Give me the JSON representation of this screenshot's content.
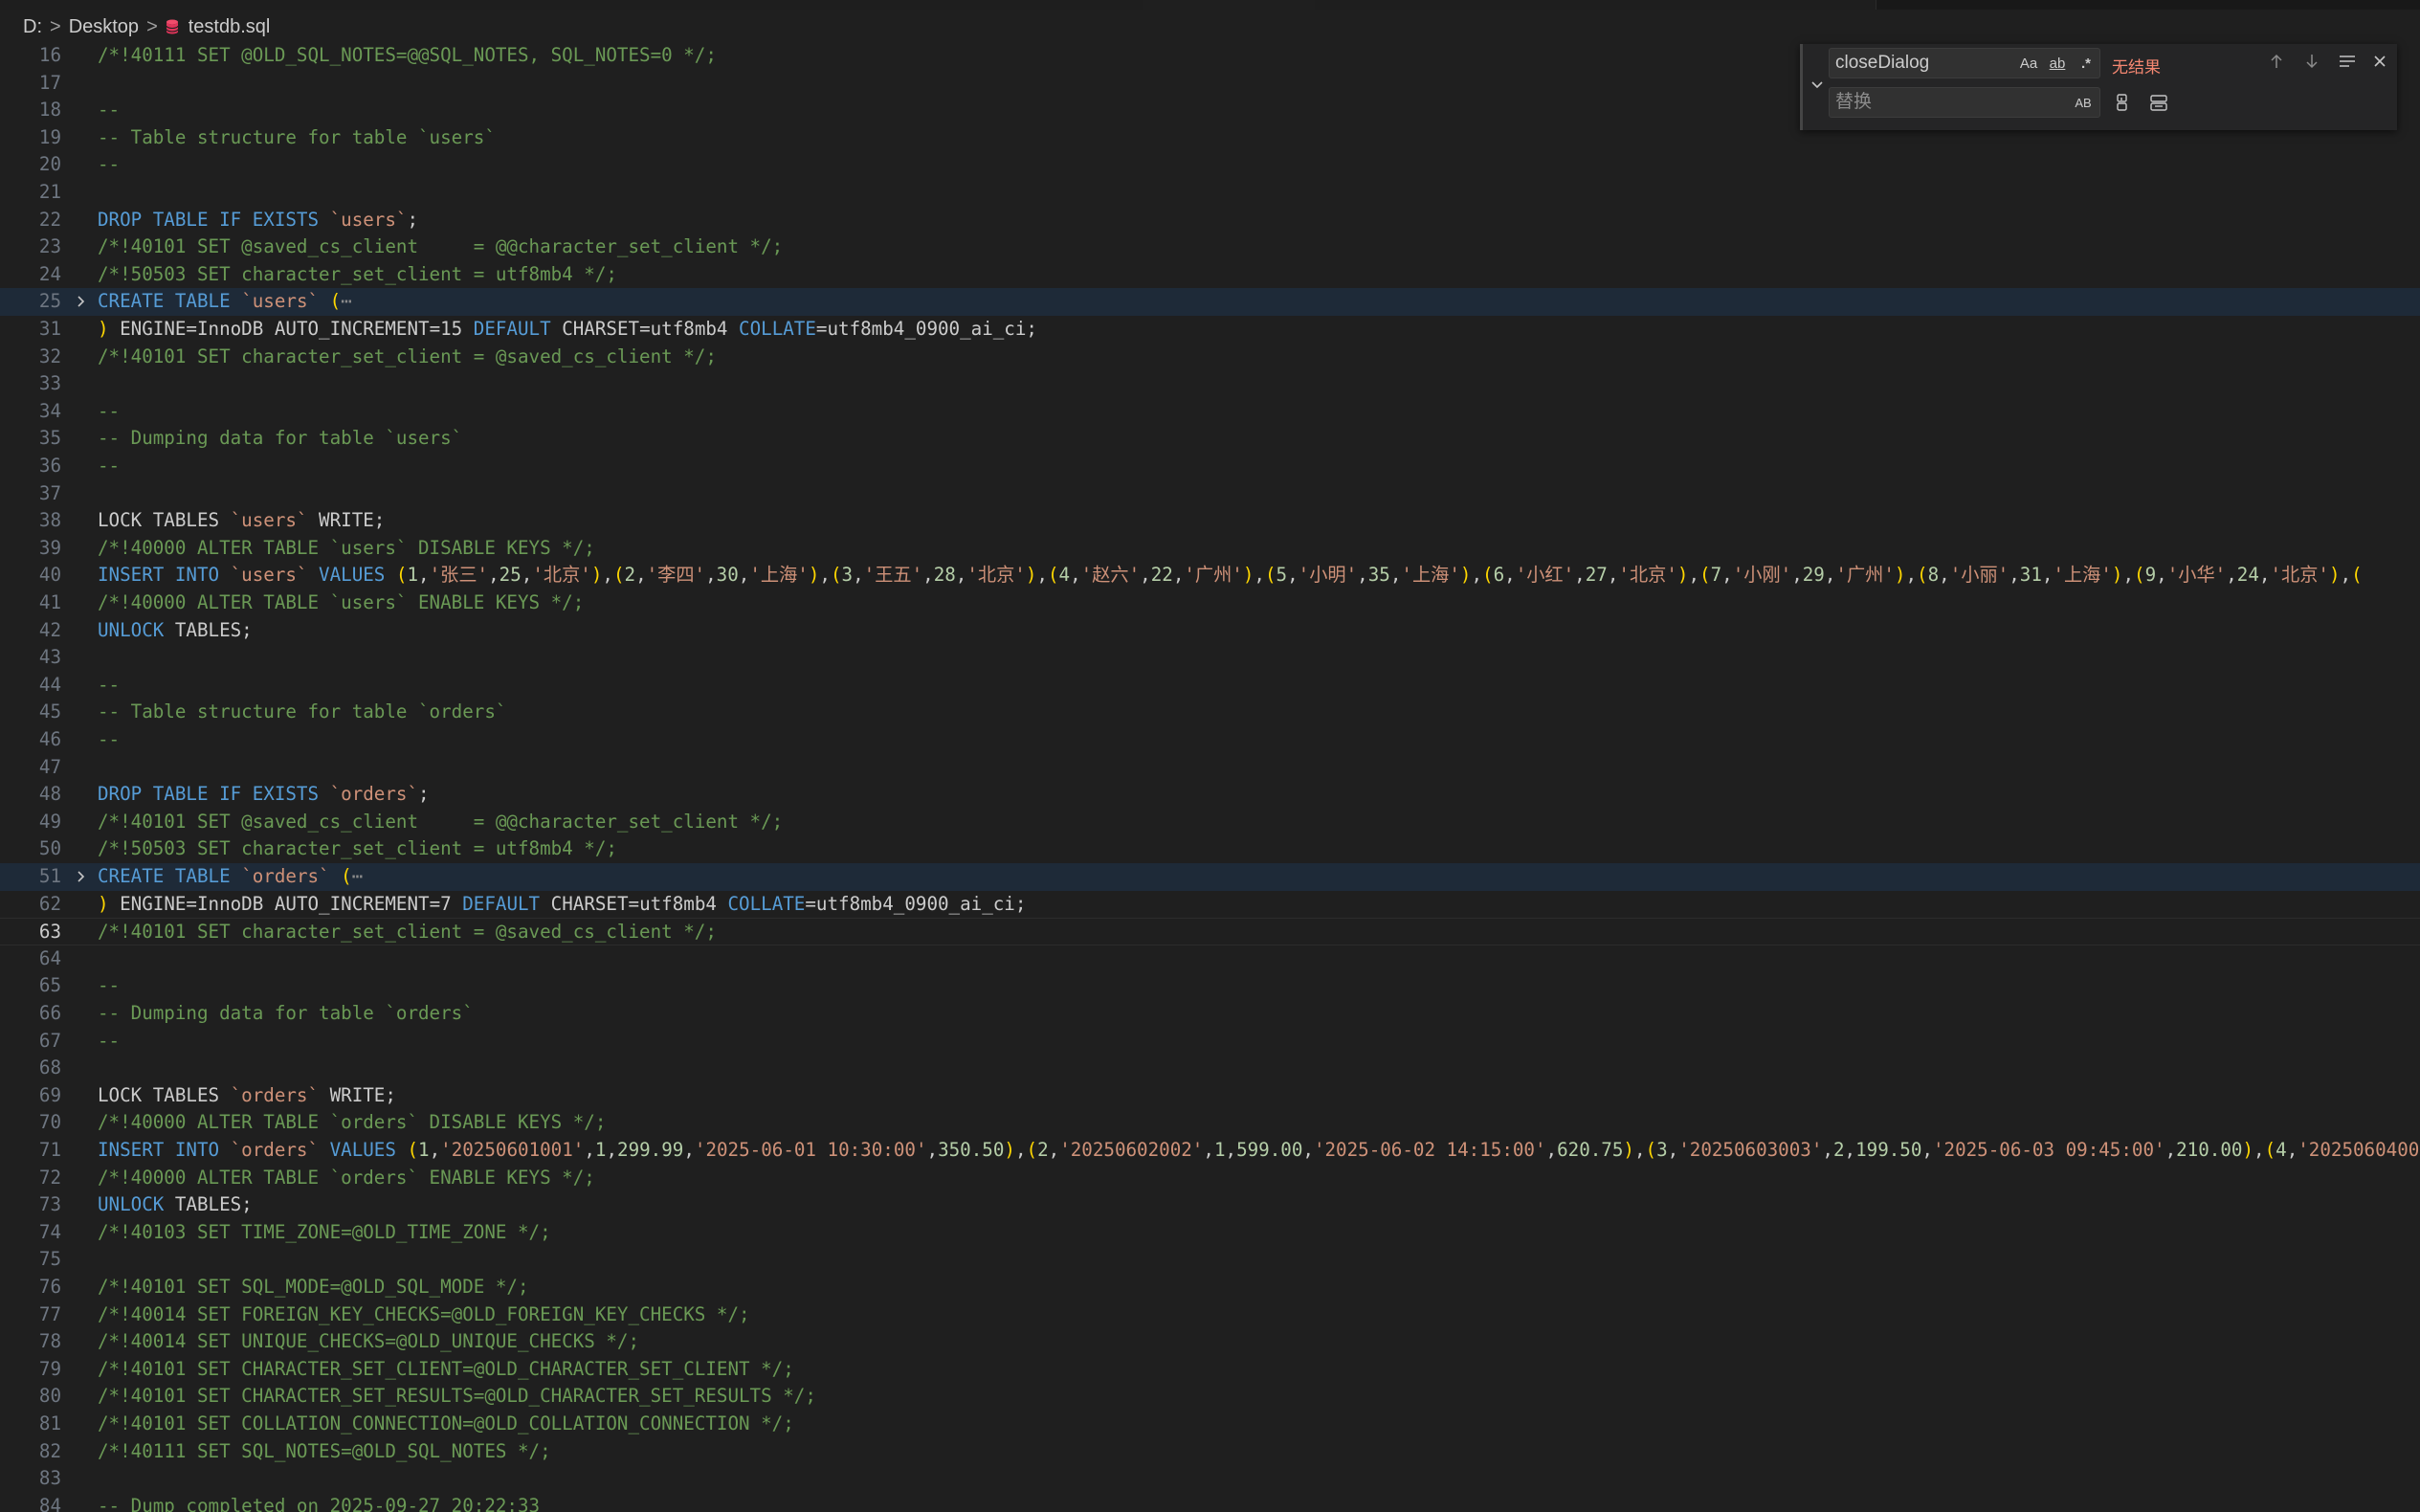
{
  "breadcrumb": {
    "drive": "D:",
    "folder": "Desktop",
    "file": "testdb.sql",
    "separator": ">"
  },
  "find": {
    "query": "closeDialog",
    "replace_placeholder": "替换",
    "no_results": "无结果",
    "match_case_label": "Aa",
    "whole_word_label": "ab",
    "regex_label": ".*",
    "preserve_case_label": "AB"
  },
  "colors": {
    "background": "#1f1f1f",
    "comment": "#6a9955",
    "keyword": "#569cd6",
    "string": "#ce9178",
    "number": "#b5cea8",
    "brace": "#ffd700",
    "line_number": "#6e7681",
    "no_results": "#f48771"
  },
  "icons": {
    "file_icon": "database-icon",
    "fold_icon": "chevron-right-icon",
    "toggle_replace_icon": "chevron-down-icon",
    "prev_match_icon": "arrow-up-icon",
    "next_match_icon": "arrow-down-icon",
    "find_in_selection_icon": "lines-icon",
    "close_icon": "close-icon",
    "replace_icon": "replace-icon",
    "replace_all_icon": "replace-all-icon"
  },
  "editor": {
    "active_line": "63",
    "lines": [
      {
        "n": "16",
        "t": [
          [
            "c",
            "/*!40111 SET @OLD_SQL_NOTES=@@SQL_NOTES, SQL_NOTES=0 */;"
          ]
        ]
      },
      {
        "n": "17",
        "t": []
      },
      {
        "n": "18",
        "t": [
          [
            "c",
            "--"
          ]
        ]
      },
      {
        "n": "19",
        "t": [
          [
            "c",
            "-- Table structure for table `users`"
          ]
        ]
      },
      {
        "n": "20",
        "t": [
          [
            "c",
            "--"
          ]
        ]
      },
      {
        "n": "21",
        "t": []
      },
      {
        "n": "22",
        "t": [
          [
            "k",
            "DROP TABLE IF EXISTS "
          ],
          [
            "s",
            "`users`"
          ],
          [
            "d",
            ";"
          ]
        ]
      },
      {
        "n": "23",
        "t": [
          [
            "c",
            "/*!40101 SET @saved_cs_client     = @@character_set_client */;"
          ]
        ]
      },
      {
        "n": "24",
        "t": [
          [
            "c",
            "/*!50503 SET character_set_client = utf8mb4 */;"
          ]
        ]
      },
      {
        "n": "25",
        "fold": true,
        "t": [
          [
            "k",
            "CREATE TABLE "
          ],
          [
            "s",
            "`users`"
          ],
          [
            "d",
            " "
          ],
          [
            "b",
            "("
          ],
          [
            "e",
            "⋯"
          ]
        ]
      },
      {
        "n": "31",
        "t": [
          [
            "b",
            ")"
          ],
          [
            "d",
            " ENGINE=InnoDB AUTO_INCREMENT=15 "
          ],
          [
            "k",
            "DEFAULT"
          ],
          [
            "d",
            " CHARSET=utf8mb4 "
          ],
          [
            "k",
            "COLLATE"
          ],
          [
            "d",
            "=utf8mb4_0900_ai_ci;"
          ]
        ]
      },
      {
        "n": "32",
        "t": [
          [
            "c",
            "/*!40101 SET character_set_client = @saved_cs_client */;"
          ]
        ]
      },
      {
        "n": "33",
        "t": []
      },
      {
        "n": "34",
        "t": [
          [
            "c",
            "--"
          ]
        ]
      },
      {
        "n": "35",
        "t": [
          [
            "c",
            "-- Dumping data for table `users`"
          ]
        ]
      },
      {
        "n": "36",
        "t": [
          [
            "c",
            "--"
          ]
        ]
      },
      {
        "n": "37",
        "t": []
      },
      {
        "n": "38",
        "t": [
          [
            "d",
            "LOCK TABLES "
          ],
          [
            "s",
            "`users`"
          ],
          [
            "d",
            " WRITE;"
          ]
        ]
      },
      {
        "n": "39",
        "t": [
          [
            "c",
            "/*!40000 ALTER TABLE `users` DISABLE KEYS */;"
          ]
        ]
      },
      {
        "n": "40",
        "t": [
          [
            "k",
            "INSERT INTO "
          ],
          [
            "s",
            "`users`"
          ],
          [
            "k",
            " VALUES "
          ],
          [
            "b",
            "("
          ],
          [
            "n",
            "1"
          ],
          [
            "d",
            ","
          ],
          [
            "s",
            "'张三'"
          ],
          [
            "d",
            ","
          ],
          [
            "n",
            "25"
          ],
          [
            "d",
            ","
          ],
          [
            "s",
            "'北京'"
          ],
          [
            "b",
            ")"
          ],
          [
            "d",
            ","
          ],
          [
            "b",
            "("
          ],
          [
            "n",
            "2"
          ],
          [
            "d",
            ","
          ],
          [
            "s",
            "'李四'"
          ],
          [
            "d",
            ","
          ],
          [
            "n",
            "30"
          ],
          [
            "d",
            ","
          ],
          [
            "s",
            "'上海'"
          ],
          [
            "b",
            ")"
          ],
          [
            "d",
            ","
          ],
          [
            "b",
            "("
          ],
          [
            "n",
            "3"
          ],
          [
            "d",
            ","
          ],
          [
            "s",
            "'王五'"
          ],
          [
            "d",
            ","
          ],
          [
            "n",
            "28"
          ],
          [
            "d",
            ","
          ],
          [
            "s",
            "'北京'"
          ],
          [
            "b",
            ")"
          ],
          [
            "d",
            ","
          ],
          [
            "b",
            "("
          ],
          [
            "n",
            "4"
          ],
          [
            "d",
            ","
          ],
          [
            "s",
            "'赵六'"
          ],
          [
            "d",
            ","
          ],
          [
            "n",
            "22"
          ],
          [
            "d",
            ","
          ],
          [
            "s",
            "'广州'"
          ],
          [
            "b",
            ")"
          ],
          [
            "d",
            ","
          ],
          [
            "b",
            "("
          ],
          [
            "n",
            "5"
          ],
          [
            "d",
            ","
          ],
          [
            "s",
            "'小明'"
          ],
          [
            "d",
            ","
          ],
          [
            "n",
            "35"
          ],
          [
            "d",
            ","
          ],
          [
            "s",
            "'上海'"
          ],
          [
            "b",
            ")"
          ],
          [
            "d",
            ","
          ],
          [
            "b",
            "("
          ],
          [
            "n",
            "6"
          ],
          [
            "d",
            ","
          ],
          [
            "s",
            "'小红'"
          ],
          [
            "d",
            ","
          ],
          [
            "n",
            "27"
          ],
          [
            "d",
            ","
          ],
          [
            "s",
            "'北京'"
          ],
          [
            "b",
            ")"
          ],
          [
            "d",
            ","
          ],
          [
            "b",
            "("
          ],
          [
            "n",
            "7"
          ],
          [
            "d",
            ","
          ],
          [
            "s",
            "'小刚'"
          ],
          [
            "d",
            ","
          ],
          [
            "n",
            "29"
          ],
          [
            "d",
            ","
          ],
          [
            "s",
            "'广州'"
          ],
          [
            "b",
            ")"
          ],
          [
            "d",
            ","
          ],
          [
            "b",
            "("
          ],
          [
            "n",
            "8"
          ],
          [
            "d",
            ","
          ],
          [
            "s",
            "'小丽'"
          ],
          [
            "d",
            ","
          ],
          [
            "n",
            "31"
          ],
          [
            "d",
            ","
          ],
          [
            "s",
            "'上海'"
          ],
          [
            "b",
            ")"
          ],
          [
            "d",
            ","
          ],
          [
            "b",
            "("
          ],
          [
            "n",
            "9"
          ],
          [
            "d",
            ","
          ],
          [
            "s",
            "'小华'"
          ],
          [
            "d",
            ","
          ],
          [
            "n",
            "24"
          ],
          [
            "d",
            ","
          ],
          [
            "s",
            "'北京'"
          ],
          [
            "b",
            ")"
          ],
          [
            "d",
            ","
          ],
          [
            "b",
            "("
          ]
        ]
      },
      {
        "n": "41",
        "t": [
          [
            "c",
            "/*!40000 ALTER TABLE `users` ENABLE KEYS */;"
          ]
        ]
      },
      {
        "n": "42",
        "t": [
          [
            "k",
            "UNLOCK"
          ],
          [
            "d",
            " TABLES;"
          ]
        ]
      },
      {
        "n": "43",
        "t": []
      },
      {
        "n": "44",
        "t": [
          [
            "c",
            "--"
          ]
        ]
      },
      {
        "n": "45",
        "t": [
          [
            "c",
            "-- Table structure for table `orders`"
          ]
        ]
      },
      {
        "n": "46",
        "t": [
          [
            "c",
            "--"
          ]
        ]
      },
      {
        "n": "47",
        "t": []
      },
      {
        "n": "48",
        "t": [
          [
            "k",
            "DROP TABLE IF EXISTS "
          ],
          [
            "s",
            "`orders`"
          ],
          [
            "d",
            ";"
          ]
        ]
      },
      {
        "n": "49",
        "t": [
          [
            "c",
            "/*!40101 SET @saved_cs_client     = @@character_set_client */;"
          ]
        ]
      },
      {
        "n": "50",
        "t": [
          [
            "c",
            "/*!50503 SET character_set_client = utf8mb4 */;"
          ]
        ]
      },
      {
        "n": "51",
        "fold": true,
        "t": [
          [
            "k",
            "CREATE TABLE "
          ],
          [
            "s",
            "`orders`"
          ],
          [
            "d",
            " "
          ],
          [
            "b",
            "("
          ],
          [
            "e",
            "⋯"
          ]
        ]
      },
      {
        "n": "62",
        "t": [
          [
            "b",
            ")"
          ],
          [
            "d",
            " ENGINE=InnoDB AUTO_INCREMENT=7 "
          ],
          [
            "k",
            "DEFAULT"
          ],
          [
            "d",
            " CHARSET=utf8mb4 "
          ],
          [
            "k",
            "COLLATE"
          ],
          [
            "d",
            "=utf8mb4_0900_ai_ci;"
          ]
        ]
      },
      {
        "n": "63",
        "t": [
          [
            "c",
            "/*!40101 SET character_set_client = @saved_cs_client */;"
          ]
        ]
      },
      {
        "n": "64",
        "t": []
      },
      {
        "n": "65",
        "t": [
          [
            "c",
            "--"
          ]
        ]
      },
      {
        "n": "66",
        "t": [
          [
            "c",
            "-- Dumping data for table `orders`"
          ]
        ]
      },
      {
        "n": "67",
        "t": [
          [
            "c",
            "--"
          ]
        ]
      },
      {
        "n": "68",
        "t": []
      },
      {
        "n": "69",
        "t": [
          [
            "d",
            "LOCK TABLES "
          ],
          [
            "s",
            "`orders`"
          ],
          [
            "d",
            " WRITE;"
          ]
        ]
      },
      {
        "n": "70",
        "t": [
          [
            "c",
            "/*!40000 ALTER TABLE `orders` DISABLE KEYS */;"
          ]
        ]
      },
      {
        "n": "71",
        "t": [
          [
            "k",
            "INSERT INTO "
          ],
          [
            "s",
            "`orders`"
          ],
          [
            "k",
            " VALUES "
          ],
          [
            "b",
            "("
          ],
          [
            "n",
            "1"
          ],
          [
            "d",
            ","
          ],
          [
            "s",
            "'20250601001'"
          ],
          [
            "d",
            ","
          ],
          [
            "n",
            "1"
          ],
          [
            "d",
            ","
          ],
          [
            "n",
            "299.99"
          ],
          [
            "d",
            ","
          ],
          [
            "s",
            "'2025-06-01 10:30:00'"
          ],
          [
            "d",
            ","
          ],
          [
            "n",
            "350.50"
          ],
          [
            "b",
            ")"
          ],
          [
            "d",
            ","
          ],
          [
            "b",
            "("
          ],
          [
            "n",
            "2"
          ],
          [
            "d",
            ","
          ],
          [
            "s",
            "'20250602002'"
          ],
          [
            "d",
            ","
          ],
          [
            "n",
            "1"
          ],
          [
            "d",
            ","
          ],
          [
            "n",
            "599.00"
          ],
          [
            "d",
            ","
          ],
          [
            "s",
            "'2025-06-02 14:15:00'"
          ],
          [
            "d",
            ","
          ],
          [
            "n",
            "620.75"
          ],
          [
            "b",
            ")"
          ],
          [
            "d",
            ","
          ],
          [
            "b",
            "("
          ],
          [
            "n",
            "3"
          ],
          [
            "d",
            ","
          ],
          [
            "s",
            "'20250603003'"
          ],
          [
            "d",
            ","
          ],
          [
            "n",
            "2"
          ],
          [
            "d",
            ","
          ],
          [
            "n",
            "199.50"
          ],
          [
            "d",
            ","
          ],
          [
            "s",
            "'2025-06-03 09:45:00'"
          ],
          [
            "d",
            ","
          ],
          [
            "n",
            "210.00"
          ],
          [
            "b",
            ")"
          ],
          [
            "d",
            ","
          ],
          [
            "b",
            "("
          ],
          [
            "n",
            "4"
          ],
          [
            "d",
            ","
          ],
          [
            "s",
            "'2025060400"
          ]
        ]
      },
      {
        "n": "72",
        "t": [
          [
            "c",
            "/*!40000 ALTER TABLE `orders` ENABLE KEYS */;"
          ]
        ]
      },
      {
        "n": "73",
        "t": [
          [
            "k",
            "UNLOCK"
          ],
          [
            "d",
            " TABLES;"
          ]
        ]
      },
      {
        "n": "74",
        "t": [
          [
            "c",
            "/*!40103 SET TIME_ZONE=@OLD_TIME_ZONE */;"
          ]
        ]
      },
      {
        "n": "75",
        "t": []
      },
      {
        "n": "76",
        "t": [
          [
            "c",
            "/*!40101 SET SQL_MODE=@OLD_SQL_MODE */;"
          ]
        ]
      },
      {
        "n": "77",
        "t": [
          [
            "c",
            "/*!40014 SET FOREIGN_KEY_CHECKS=@OLD_FOREIGN_KEY_CHECKS */;"
          ]
        ]
      },
      {
        "n": "78",
        "t": [
          [
            "c",
            "/*!40014 SET UNIQUE_CHECKS=@OLD_UNIQUE_CHECKS */;"
          ]
        ]
      },
      {
        "n": "79",
        "t": [
          [
            "c",
            "/*!40101 SET CHARACTER_SET_CLIENT=@OLD_CHARACTER_SET_CLIENT */;"
          ]
        ]
      },
      {
        "n": "80",
        "t": [
          [
            "c",
            "/*!40101 SET CHARACTER_SET_RESULTS=@OLD_CHARACTER_SET_RESULTS */;"
          ]
        ]
      },
      {
        "n": "81",
        "t": [
          [
            "c",
            "/*!40101 SET COLLATION_CONNECTION=@OLD_COLLATION_CONNECTION */;"
          ]
        ]
      },
      {
        "n": "82",
        "t": [
          [
            "c",
            "/*!40111 SET SQL_NOTES=@OLD_SQL_NOTES */;"
          ]
        ]
      },
      {
        "n": "83",
        "t": []
      },
      {
        "n": "84",
        "t": [
          [
            "c",
            "-- Dump completed on 2025-09-27 20:22:33"
          ]
        ]
      }
    ]
  }
}
